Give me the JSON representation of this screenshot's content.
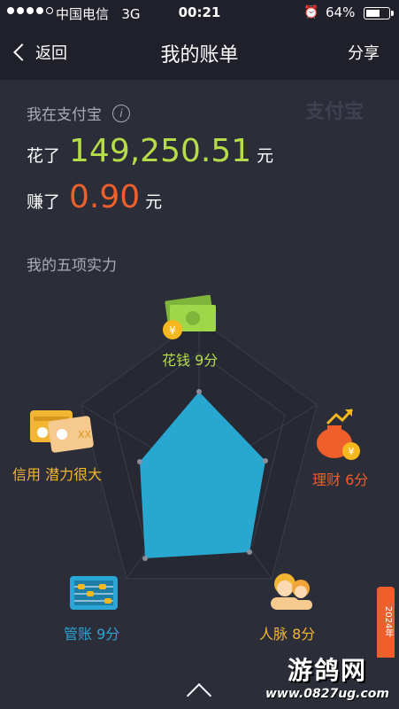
{
  "status": {
    "carrier": "中国电信",
    "network": "3G",
    "time": "00:21",
    "battery": "64%",
    "battery_level": 0.64
  },
  "nav": {
    "back_label": "返回",
    "title": "我的账单",
    "share_label": "分享"
  },
  "summary": {
    "subtitle": "我在支付宝",
    "logo_text": "支付宝",
    "spent_label": "花了",
    "spent_amount": "149,250.51",
    "earned_label": "赚了",
    "earned_amount": "0.90",
    "currency": "元"
  },
  "abilities": {
    "title": "我的五项实力",
    "items": [
      {
        "label": "花钱 9分",
        "score": 9,
        "icon": "money-icon",
        "color": "#b6dc4a"
      },
      {
        "label": "理财 6分",
        "score": 6,
        "icon": "money-bag-icon",
        "color": "#ef5f2c"
      },
      {
        "label": "人脉 8分",
        "score": 8,
        "icon": "people-icon",
        "color": "#f2b632"
      },
      {
        "label": "管账 9分",
        "score": 9,
        "icon": "abacus-icon",
        "color": "#2aa6d6"
      },
      {
        "label": "信用 潜力很大",
        "score": 6,
        "icon": "id-card-icon",
        "color": "#f2b632"
      }
    ]
  },
  "colors": {
    "accent_blue": "#28a8d0",
    "spent_green": "#b6dc4a",
    "earned_red": "#ef5f2c"
  },
  "watermark": {
    "big": "游鸽网",
    "small": "www.0827ug.com",
    "year_tag": "2024年"
  }
}
